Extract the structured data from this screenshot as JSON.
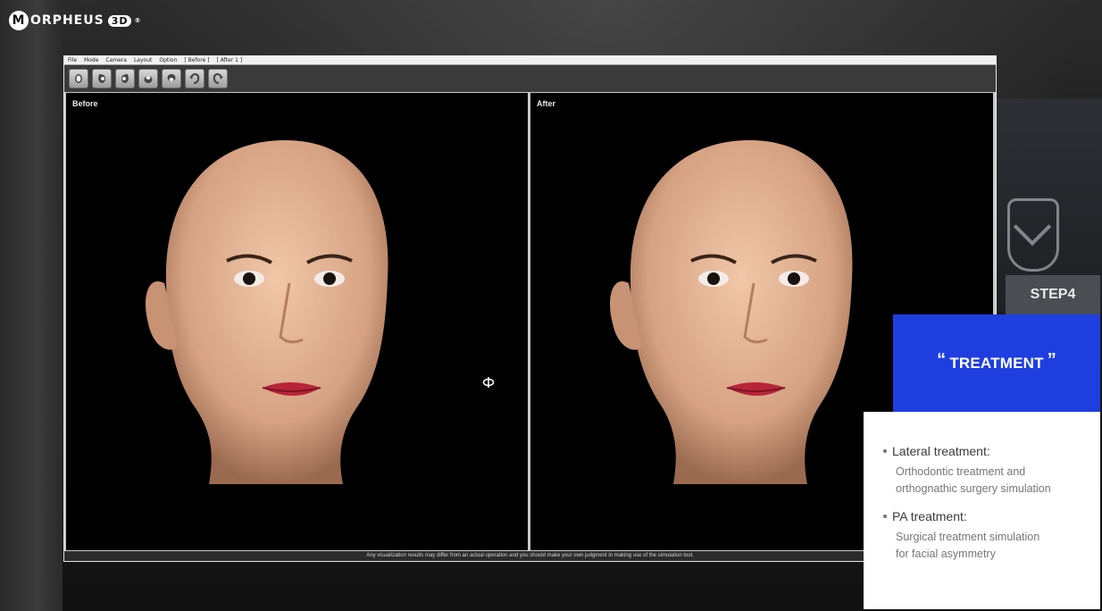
{
  "brand": {
    "m": "M",
    "name": "ORPHEUS",
    "suffix": "3D",
    "reg": "®"
  },
  "app": {
    "menu": [
      "File",
      "Mode",
      "Camera",
      "Layout",
      "Option",
      "[ Before ]",
      "[ After 1 ]"
    ],
    "toolbar": [
      {
        "icon": "head-front-icon"
      },
      {
        "icon": "head-left-icon"
      },
      {
        "icon": "head-right-icon"
      },
      {
        "icon": "head-top-icon"
      },
      {
        "icon": "head-bottom-icon"
      },
      {
        "icon": "head-rotate-left-icon"
      },
      {
        "icon": "head-rotate-right-icon"
      }
    ],
    "viewports": {
      "before_label": "Before",
      "after_label": "After"
    },
    "status_text": "Any visualization results may differ from an actual operation and you should make your own judgment in making use of the simulation tool."
  },
  "card": {
    "step": "STEP4",
    "title": "TREATMENT",
    "open_quote": "“",
    "close_quote": "”",
    "items": [
      {
        "head": "Lateral treatment:",
        "desc_lines": [
          "Orthodontic treatment and",
          "orthognathic surgery simulation"
        ]
      },
      {
        "head": "PA treatment:",
        "desc_lines": [
          "Surgical treatment simulation",
          "for facial asymmetry"
        ]
      }
    ]
  },
  "colors": {
    "accent_blue": "#1f3ee0",
    "step_tab": "#4a4d52",
    "viewport_bg": "#000000",
    "skin": "#d9a98a"
  }
}
